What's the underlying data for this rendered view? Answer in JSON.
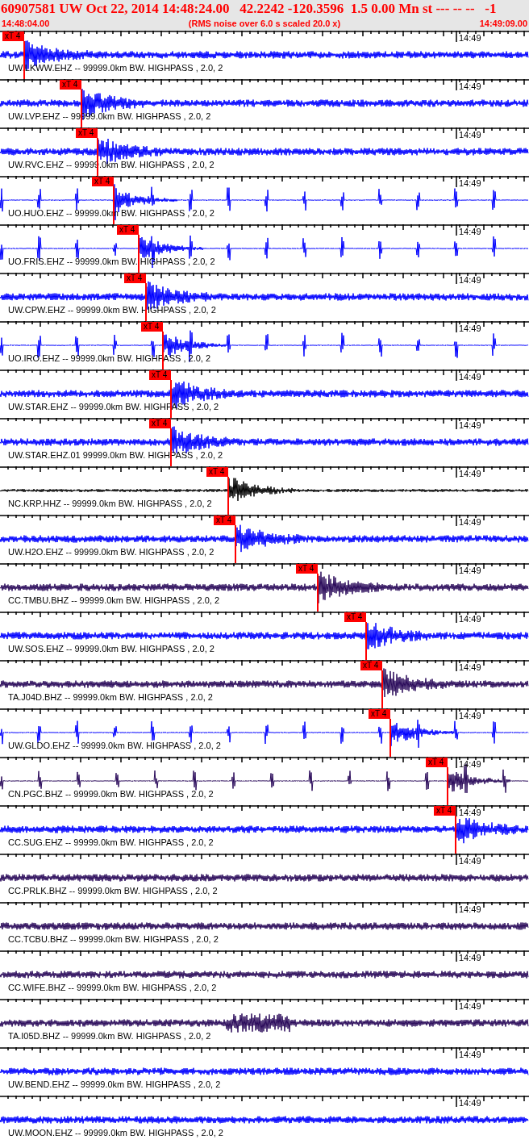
{
  "header": {
    "title": "60907581 UW Oct 22, 2014 14:48:24.00   42.2242 -120.3596  1.5 0.00 Mn st --- -- --   -1",
    "start_time": "14:48:04.00",
    "note": "(RMS noise over 6.0 s scaled 20.0 x)",
    "end_time": "14:49:09.00"
  },
  "traces": [
    {
      "label": "UW.LKWW.EHZ -- 99999.0km BW. HIGHPASS , 2.0, 2",
      "color": "#0000ff",
      "time_label": "14:49",
      "pick": "xT 4"
    },
    {
      "label": "UW.LVP.EHZ -- 99999.0km BW. HIGHPASS , 2.0, 2",
      "color": "#0000ff",
      "time_label": "14:49",
      "pick": "xT 4"
    },
    {
      "label": "UW.RVC.EHZ -- 99999.0km BW. HIGHPASS , 2.0, 2",
      "color": "#0000ff",
      "time_label": "14:49",
      "pick": "xT 4"
    },
    {
      "label": "UO.HUO.EHZ -- 99999.0km BW. HIGHPASS , 2.0, 2",
      "color": "#0000ff",
      "time_label": "14:49",
      "pick": "xT 4"
    },
    {
      "label": "UO.FRIS.EHZ -- 99999.0km BW. HIGHPASS , 2.0, 2",
      "color": "#0000ff",
      "time_label": "14:49",
      "pick": "xT 4"
    },
    {
      "label": "UW.CPW.EHZ -- 99999.0km BW. HIGHPASS , 2.0, 2",
      "color": "#0000ff",
      "time_label": "14:49",
      "pick": "xT 4"
    },
    {
      "label": "UO.IRO.EHZ -- 99999.0km BW. HIGHPASS , 2.0, 2",
      "color": "#0000ff",
      "time_label": "14:49",
      "pick": "xT 4"
    },
    {
      "label": "UW.STAR.EHZ -- 99999.0km BW. HIGHPASS , 2.0, 2",
      "color": "#0000ff",
      "time_label": "14:49",
      "pick": "xT 4"
    },
    {
      "label": "UW.STAR.EHZ.01 99999.0km BW. HIGHPASS , 2.0, 2",
      "color": "#0000ff",
      "time_label": "14:49",
      "pick": "xT 4"
    },
    {
      "label": "NC.KRP.HHZ -- 99999.0km BW. HIGHPASS , 2.0, 2",
      "color": "#000000",
      "time_label": "14:49",
      "pick": "xT 4"
    },
    {
      "label": "UW.H2O.EHZ -- 99999.0km BW. HIGHPASS , 2.0, 2",
      "color": "#0000ff",
      "time_label": "14:49",
      "pick": "xT 4"
    },
    {
      "label": "CC.TMBU.BHZ -- 99999.0km BW. HIGHPASS , 2.0, 2",
      "color": "#2a0a5a",
      "time_label": "14:49",
      "pick": "xT 4"
    },
    {
      "label": "UW.SOS.EHZ -- 99999.0km BW. HIGHPASS , 2.0, 2",
      "color": "#0000ff",
      "time_label": "14:49",
      "pick": "xT 4"
    },
    {
      "label": "TA.J04D.BHZ -- 99999.0km BW. HIGHPASS , 2.0, 2",
      "color": "#2a0a5a",
      "time_label": "14:49",
      "pick": "xT 4"
    },
    {
      "label": "UW.GLDO.EHZ -- 99999.0km BW. HIGHPASS , 2.0, 2",
      "color": "#0000ff",
      "time_label": "14:49",
      "pick": "xT 4"
    },
    {
      "label": "CN.PGC.BHZ -- 99999.0km BW. HIGHPASS , 2.0, 2",
      "color": "#2a0a5a",
      "time_label": "14:49",
      "pick": "xT 4"
    },
    {
      "label": "CC.SUG.EHZ -- 99999.0km BW. HIGHPASS , 2.0, 2",
      "color": "#0000ff",
      "time_label": "14:49",
      "pick": "xT 4"
    },
    {
      "label": "CC.PRLK.BHZ -- 99999.0km BW. HIGHPASS , 2.0, 2",
      "color": "#2a0a5a",
      "time_label": "14:49"
    },
    {
      "label": "CC.TCBU.BHZ -- 99999.0km BW. HIGHPASS , 2.0, 2",
      "color": "#2a0a5a",
      "time_label": "14:49"
    },
    {
      "label": "CC.WIFE.BHZ -- 99999.0km BW. HIGHPASS , 2.0, 2",
      "color": "#2a0a5a",
      "time_label": "14:49"
    },
    {
      "label": "TA.I05D.BHZ -- 99999.0km BW. HIGHPASS , 2.0, 2",
      "color": "#2a0a5a",
      "time_label": "14:49"
    },
    {
      "label": "UW.BEND.EHZ -- 99999.0km BW. HIGHPASS , 2.0, 2",
      "color": "#0000ff",
      "time_label": "14:49"
    },
    {
      "label": "UW.MOON.EHZ -- 99999.0km BW. HIGHPASS , 2.0, 2",
      "color": "#0000ff",
      "time_label": "14:49"
    }
  ]
}
